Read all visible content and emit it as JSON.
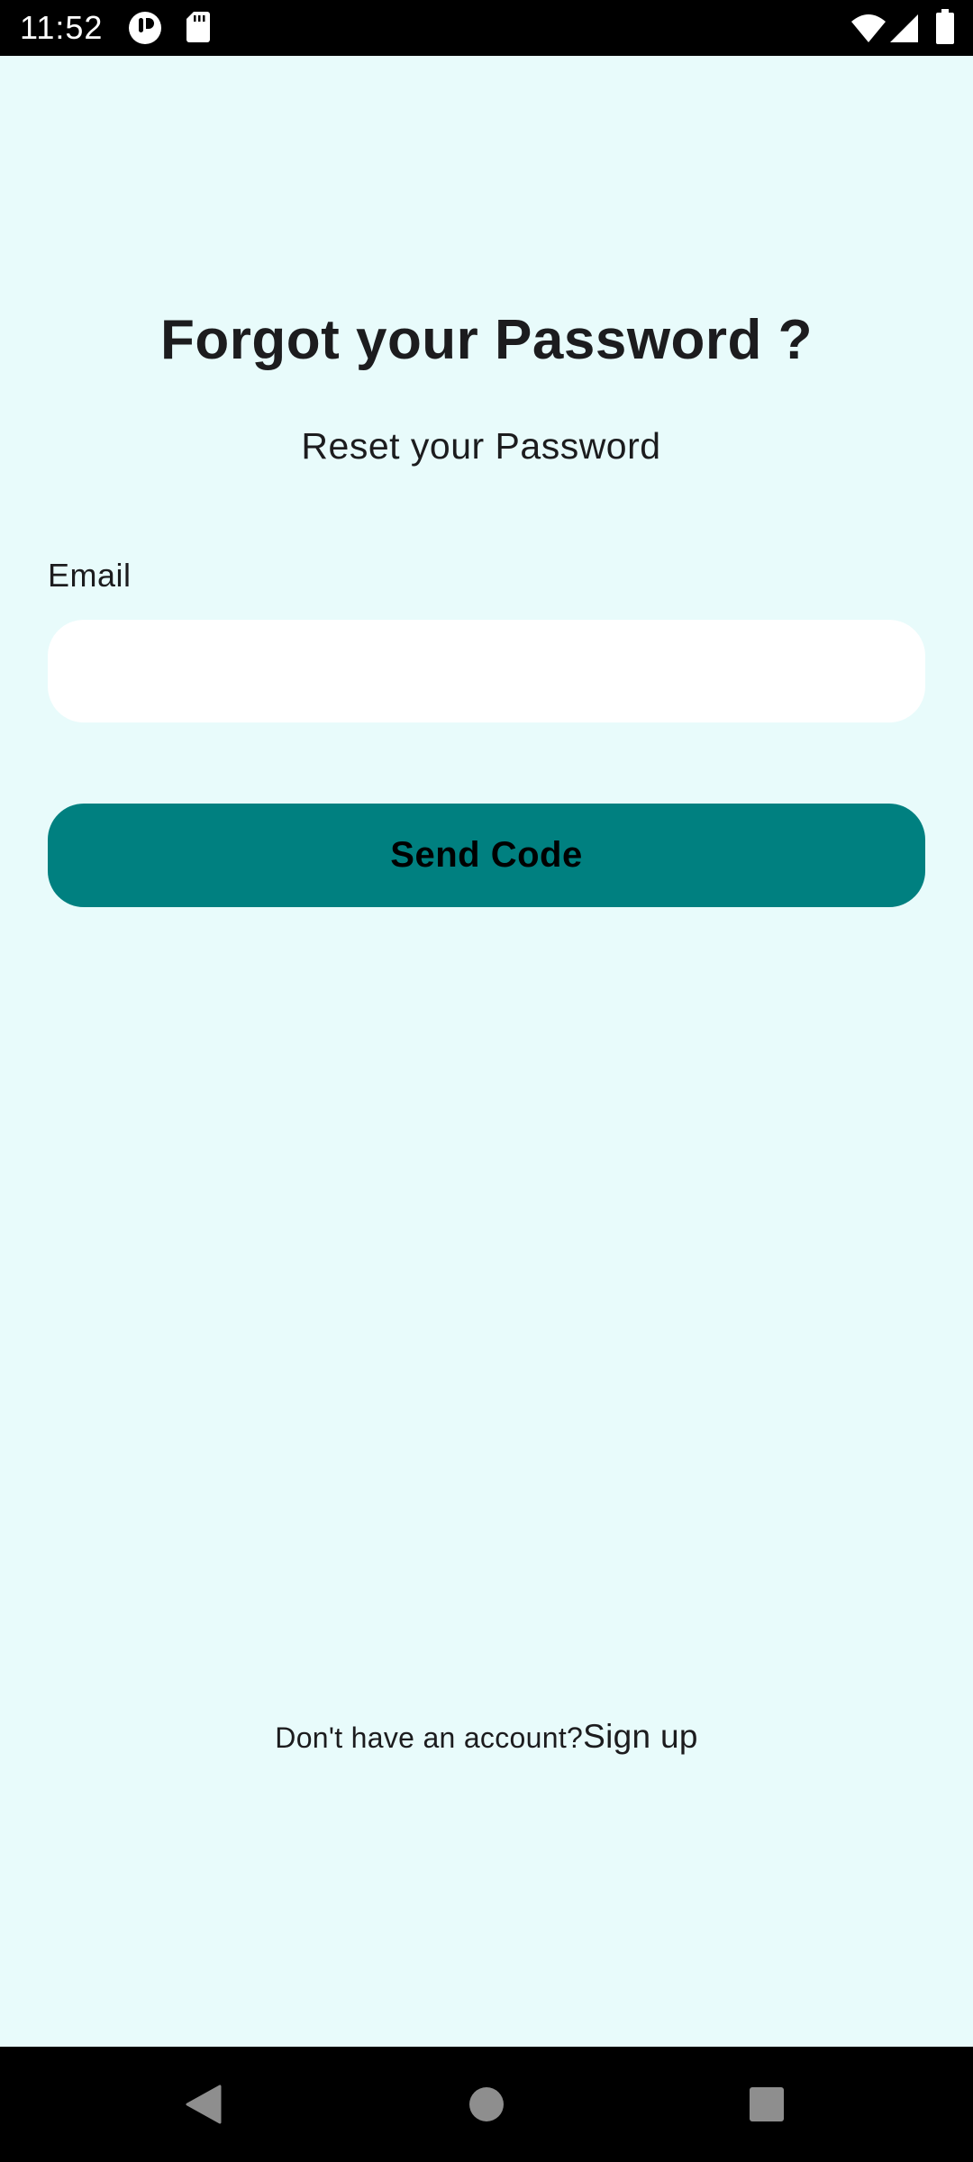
{
  "status_bar": {
    "time": "11:52",
    "icons": [
      "app-notification-icon",
      "sd-card-icon",
      "wifi-icon",
      "cellular-signal-icon",
      "battery-icon"
    ]
  },
  "header": {
    "title": "Forgot your Password ?",
    "subtitle": "Reset your Password"
  },
  "form": {
    "email_label": "Email",
    "email_value": "",
    "send_button_label": "Send Code"
  },
  "footer": {
    "signup_prompt": "Don't have an account?",
    "signup_link": "Sign up"
  },
  "navigation": {
    "icons": [
      "back-icon",
      "home-icon",
      "recents-icon"
    ]
  },
  "colors": {
    "background": "#e8fbfb",
    "accent": "#008080",
    "input_background": "#ffffff",
    "system_bars": "#000000"
  }
}
